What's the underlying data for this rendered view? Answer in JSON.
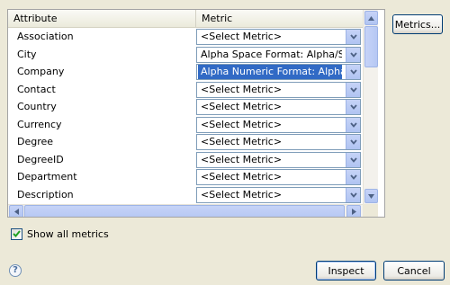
{
  "table": {
    "headers": {
      "attribute": "Attribute",
      "metric": "Metric"
    },
    "rows": [
      {
        "attribute": "Association",
        "metric": "<Select Metric>"
      },
      {
        "attribute": "City",
        "metric": "Alpha Space Format:  Alpha/Space"
      },
      {
        "attribute": "Company",
        "metric": "Alpha Numeric Format:  Alpha/Num",
        "selected": true
      },
      {
        "attribute": "Contact",
        "metric": "<Select Metric>"
      },
      {
        "attribute": "Country",
        "metric": "<Select Metric>"
      },
      {
        "attribute": "Currency",
        "metric": "<Select Metric>"
      },
      {
        "attribute": "Degree",
        "metric": "<Select Metric>"
      },
      {
        "attribute": "DegreeID",
        "metric": "<Select Metric>"
      },
      {
        "attribute": "Department",
        "metric": "<Select Metric>"
      },
      {
        "attribute": "Description",
        "metric": "<Select Metric>"
      }
    ]
  },
  "buttons": {
    "metrics": "Metrics...",
    "inspect": "Inspect",
    "cancel": "Cancel"
  },
  "options": {
    "show_all_metrics_label": "Show all metrics",
    "show_all_metrics_checked": true
  },
  "help": {
    "glyph": "?"
  },
  "icons": {
    "dropdown": "chevron-down-icon",
    "scroll_up": "scroll-up-arrow-icon",
    "scroll_down": "scroll-down-arrow-icon",
    "scroll_left": "scroll-left-arrow-icon",
    "scroll_right": "scroll-right-arrow-icon",
    "check": "checkmark-icon",
    "help": "help-icon"
  },
  "colors": {
    "selection": "#316ac5",
    "dialog_bg": "#ece9d8",
    "button_border": "#003c74"
  }
}
